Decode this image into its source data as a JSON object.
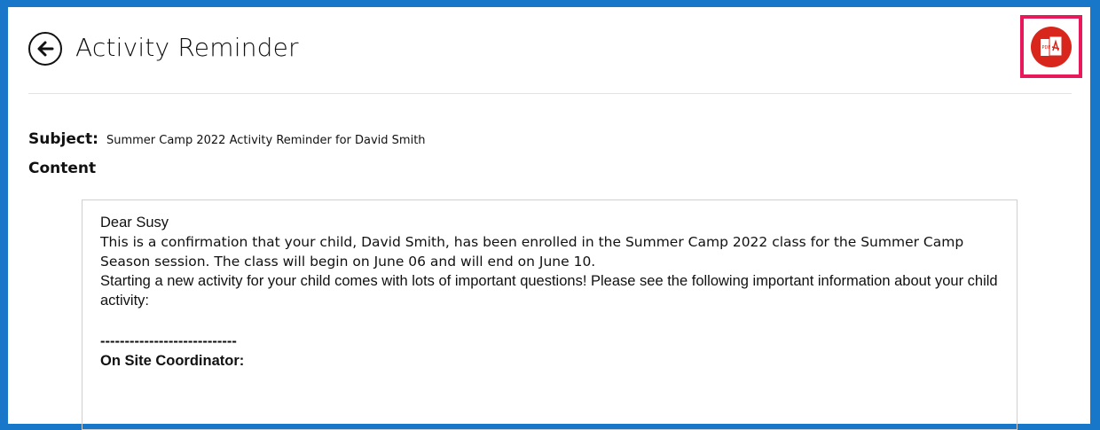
{
  "header": {
    "title": "Activity Reminder",
    "back_icon": "arrow-left-circle-icon",
    "pdf_icon": "pdf-export-icon",
    "pdf_icon_text": "PDF"
  },
  "subject": {
    "label": "Subject:",
    "value": "Summer Camp 2022 Activity Reminder for David Smith"
  },
  "content": {
    "label": "Content",
    "greeting": "Dear Susy",
    "paragraph1": "This is a confirmation that your child, David Smith, has been enrolled in the Summer Camp 2022 class for the Summer Camp Season session. The class will begin on June 06 and will end on June 10.",
    "paragraph2": "Starting a new activity for your child comes with lots of important questions! Please see the following important information about your child activity:",
    "separator": "----------------------------",
    "section_heading": "On Site Coordinator:"
  },
  "colors": {
    "background_blue": "#1877c9",
    "highlight_pink": "#e8185b",
    "pdf_red": "#d9261c"
  }
}
